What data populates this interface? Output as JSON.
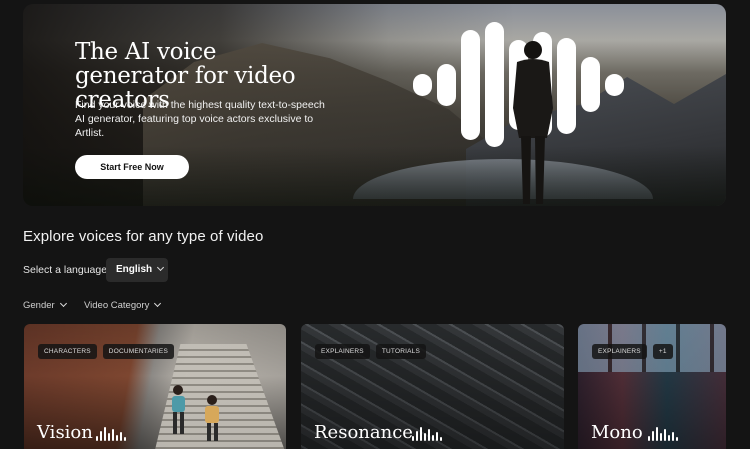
{
  "hero": {
    "title": "The AI voice generator for video creators",
    "description": "Find your voice with the highest quality text-to-speech AI generator, featuring top voice actors exclusive to Artlist.",
    "cta_label": "Start Free Now"
  },
  "explore": {
    "title": "Explore voices for any type of video",
    "language_label": "Select a language",
    "language_value": "English",
    "filters": [
      {
        "label": "Gender"
      },
      {
        "label": "Video Category"
      }
    ]
  },
  "cards": [
    {
      "name": "Vision",
      "tags": [
        "CHARACTERS",
        "DOCUMENTARIES"
      ]
    },
    {
      "name": "Resonance",
      "tags": [
        "EXPLAINERS",
        "TUTORIALS"
      ]
    },
    {
      "name": "Mono",
      "tags": [
        "EXPLAINERS",
        "+1"
      ]
    }
  ],
  "icons": {
    "voice_waveform": "sound-wave-icon",
    "dropdown": "chevron-down-icon"
  },
  "colors": {
    "background": "#141414",
    "cta_background": "#ffffff",
    "select_background": "#2b2b2b"
  }
}
